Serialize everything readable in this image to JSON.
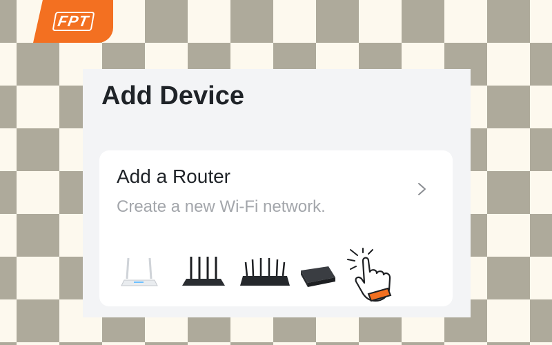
{
  "brand": {
    "logo_text": "FPT",
    "color": "#f37021"
  },
  "screen": {
    "title": "Add Device",
    "card": {
      "title": "Add a Router",
      "subtitle": "Create a new Wi-Fi network.",
      "chevron_icon": "chevron-right-icon",
      "devices": [
        "router-2-antenna-icon",
        "router-4-antenna-icon",
        "router-6-antenna-icon",
        "mobile-router-icon"
      ],
      "hand_icon": "tap-hand-icon"
    }
  },
  "colors": {
    "checker_dark": "#aeaa9b",
    "checker_light": "#fdf9ee",
    "panel_bg": "#f3f4f6",
    "card_bg": "#ffffff",
    "accent": "#f37021"
  }
}
